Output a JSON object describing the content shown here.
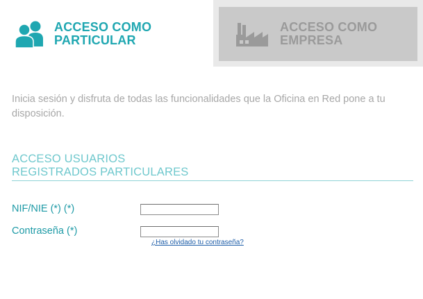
{
  "tabs": {
    "particular": {
      "line1": "ACCESO COMO",
      "line2": "PARTICULAR",
      "icon": "users-icon",
      "color": "#1fa7b1"
    },
    "empresa": {
      "line1": "ACCESO COMO",
      "line2": "EMPRESA",
      "icon": "factory-icon",
      "color": "#9a9a9a"
    }
  },
  "intro": {
    "text": "Inicia sesión y disfruta de todas las funcionalidades que la Oficina en Red pone a tu disposición."
  },
  "section": {
    "heading_line1": "ACCESO USUARIOS",
    "heading_line2": "REGISTRADOS PARTICULARES"
  },
  "form": {
    "nif_label": "NIF/NIE (*) (*)",
    "nif_value": "",
    "password_label": "Contraseña (*)",
    "password_value": "",
    "forgot_link": "¿Has olvidado tu contraseña?"
  },
  "colors": {
    "accent": "#1fa7b1",
    "heading": "#6fc8cd",
    "intro_text": "#a7a7a7",
    "link": "#1d5da8"
  }
}
